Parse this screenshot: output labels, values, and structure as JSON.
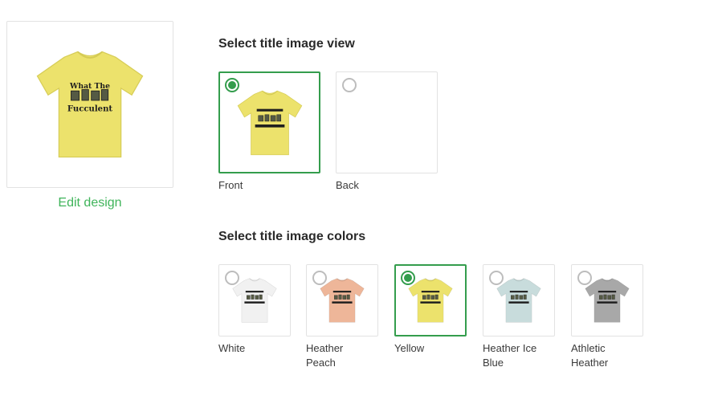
{
  "preview": {
    "edit_label": "Edit design",
    "shirt_color": "#ece26c",
    "design_text": [
      "What The",
      "Fucculent"
    ]
  },
  "view_section": {
    "title": "Select title image view",
    "options": [
      {
        "label": "Front",
        "selected": true
      },
      {
        "label": "Back",
        "selected": false
      }
    ]
  },
  "color_section": {
    "title": "Select title image colors",
    "options": [
      {
        "label": "White",
        "color": "#f1f1f1",
        "selected": false
      },
      {
        "label": "Heather Peach",
        "color": "#eeb699",
        "selected": false
      },
      {
        "label": "Yellow",
        "color": "#ece26c",
        "selected": true
      },
      {
        "label": "Heather Ice Blue",
        "color": "#c8dcdc",
        "selected": false
      },
      {
        "label": "Athletic Heather",
        "color": "#a8a8a8",
        "selected": false
      }
    ]
  },
  "theme": {
    "accent": "#349d4d",
    "link": "#3fb45a"
  }
}
